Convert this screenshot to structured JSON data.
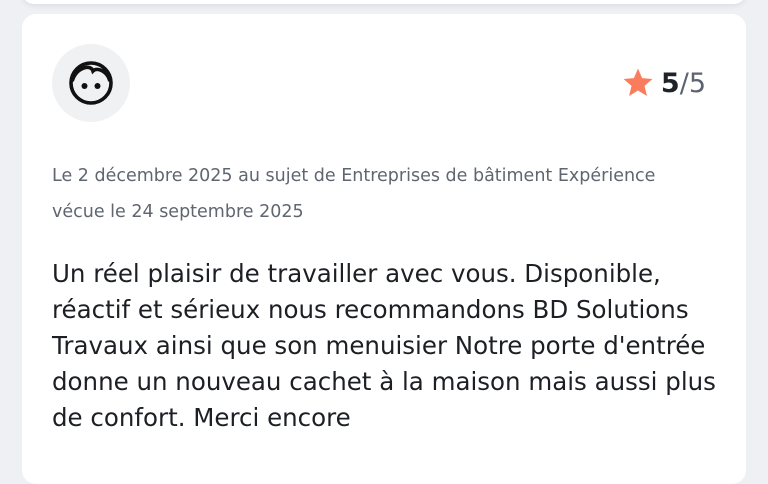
{
  "review": {
    "avatar_icon": "face-icon",
    "rating": {
      "icon": "star-icon",
      "star_color": "#f97d5c",
      "score": "5",
      "max": "/5"
    },
    "meta": {
      "line1": "Le 2 décembre 2025 au sujet de Entreprises de bâtiment Expérience",
      "line2": "vécue le 24 septembre 2025"
    },
    "text": "Un réel plaisir de travailler avec vous. Disponible, réactif et sérieux nous recommandons BD Solutions Travaux ainsi que son menuisier Notre porte d'entrée donne un nouveau cachet à la maison mais aussi plus de confort. Merci encore"
  }
}
